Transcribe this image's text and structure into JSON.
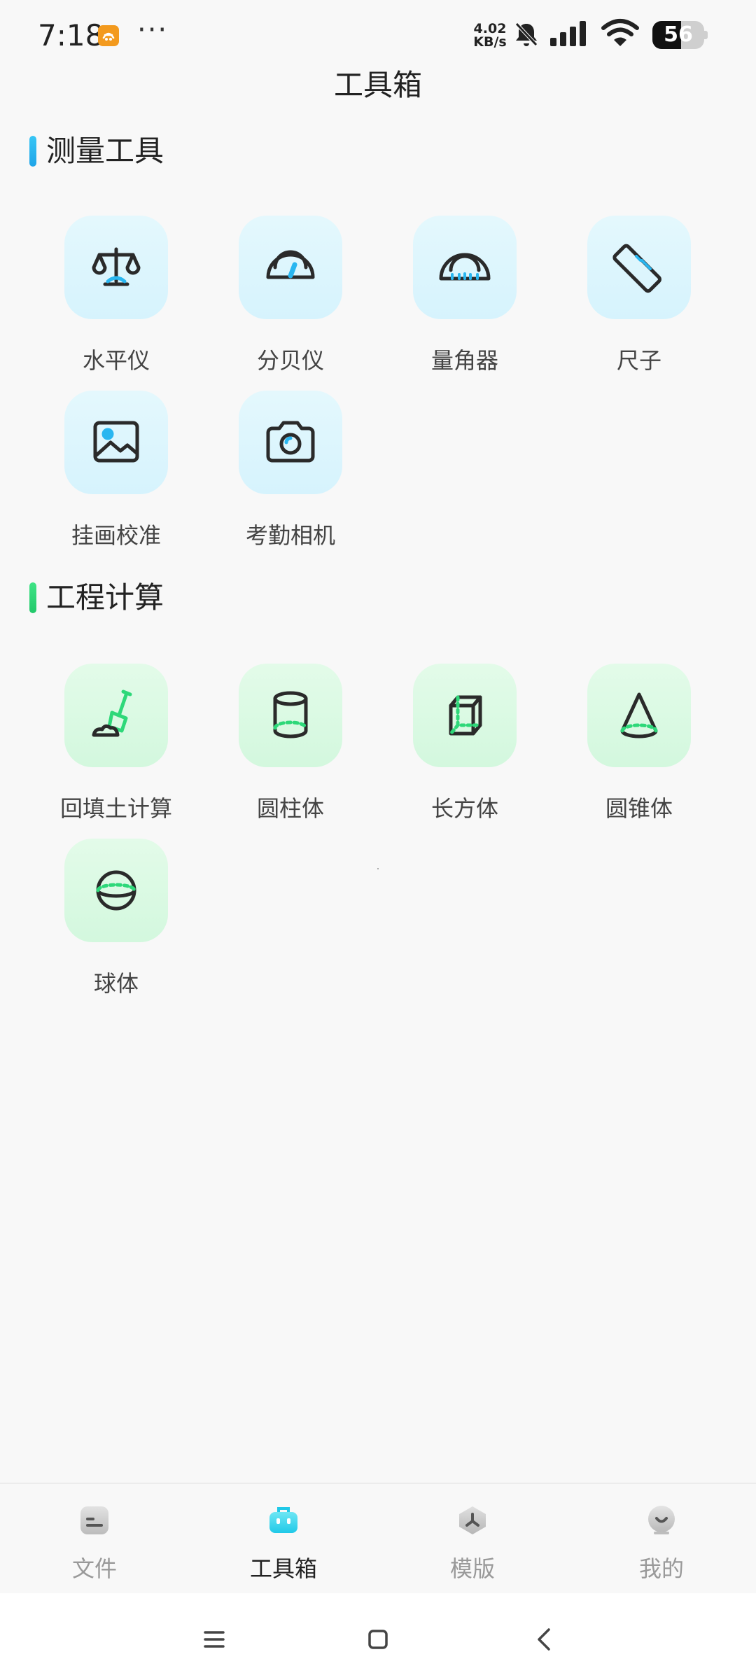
{
  "status_bar": {
    "time": "7:18",
    "more_indicator": "···",
    "net_speed_value": "4.02",
    "net_speed_unit": "KB/s",
    "battery_level": 56,
    "battery_text": "56",
    "icons": [
      "app-notification-icon",
      "bell-off-icon",
      "signal-icon",
      "wifi-icon",
      "battery-icon"
    ]
  },
  "header": {
    "title": "工具箱"
  },
  "sections": [
    {
      "title": "测量工具",
      "accent": "#2bb8f0",
      "items": [
        {
          "label": "水平仪",
          "icon": "balance-icon"
        },
        {
          "label": "分贝仪",
          "icon": "gauge-icon"
        },
        {
          "label": "量角器",
          "icon": "protractor-icon"
        },
        {
          "label": "尺子",
          "icon": "ruler-icon"
        },
        {
          "label": "挂画校准",
          "icon": "picture-icon"
        },
        {
          "label": "考勤相机",
          "icon": "camera-icon"
        }
      ]
    },
    {
      "title": "工程计算",
      "accent": "#2ed879",
      "items": [
        {
          "label": "回填土计算",
          "icon": "shovel-icon"
        },
        {
          "label": "圆柱体",
          "icon": "cylinder-icon"
        },
        {
          "label": "长方体",
          "icon": "cuboid-icon"
        },
        {
          "label": "圆锥体",
          "icon": "cone-icon"
        },
        {
          "label": "球体",
          "icon": "sphere-icon"
        }
      ]
    }
  ],
  "bottom_nav": {
    "active_index": 1,
    "items": [
      {
        "label": "文件",
        "icon": "file-icon"
      },
      {
        "label": "工具箱",
        "icon": "toolbox-icon"
      },
      {
        "label": "模版",
        "icon": "template-icon"
      },
      {
        "label": "我的",
        "icon": "profile-icon"
      }
    ]
  },
  "system_nav": {
    "icons": [
      "menu-icon",
      "home-icon",
      "back-icon"
    ]
  },
  "colors": {
    "blue_accent": "#2bb8f0",
    "green_accent": "#2ed879",
    "blue_tile": "#dff6fd",
    "green_tile": "#dcfae4",
    "active_nav": "#222222",
    "inactive_nav": "#999999"
  }
}
